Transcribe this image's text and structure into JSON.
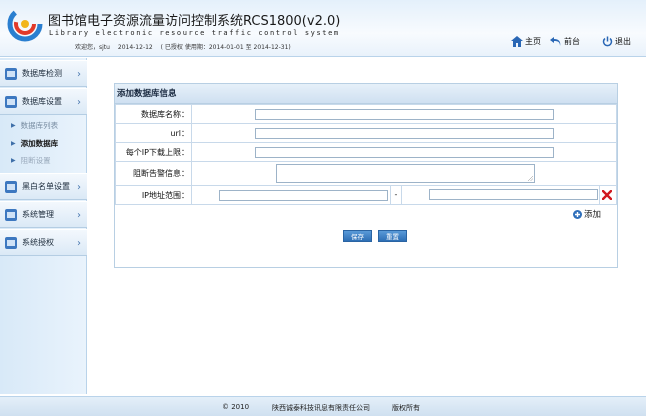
{
  "header": {
    "title_cn": "图书馆电子资源流量访问控制系统RCS1800(v2.0)",
    "title_en": "Library electronic resource traffic control system",
    "welcome_label": "欢迎您，sjtu",
    "date": "2014-12-12",
    "license": "( 已授权 使用期：2014-01-01 至 2014-12-31)",
    "nav": {
      "home": "主页",
      "back": "前台",
      "logout": "退出"
    }
  },
  "sidebar": {
    "items": [
      {
        "label": "数据库检测",
        "icon": "database-icon"
      },
      {
        "label": "数据库设置",
        "icon": "database-settings-icon"
      },
      {
        "label": "黑白名单设置",
        "icon": "blacklist-icon"
      },
      {
        "label": "系统管理",
        "icon": "system-icon"
      },
      {
        "label": "系统授权",
        "icon": "license-icon"
      }
    ],
    "subitems": [
      {
        "label": "数据库列表",
        "color": "#7a8ea3"
      },
      {
        "label": "添加数据库",
        "color": "#1a1a1a"
      },
      {
        "label": "阻断设置",
        "color": "#9aaabc"
      }
    ]
  },
  "form": {
    "title": "添加数据库信息",
    "fields": {
      "name_label": "数据库名称：",
      "url_label": "url：",
      "limit_label": "每个IP下载上限：",
      "alert_label": "阻断告警信息：",
      "ip_label": "IP地址范围：",
      "ip_separator": "-"
    },
    "add_label": "添加",
    "save_label": "保存",
    "reset_label": "重置"
  },
  "footer": {
    "copyright": "© 2010",
    "company": "陕西诚泰科技讯息有限责任公司",
    "rights": "版权所有"
  },
  "colors": {
    "accent": "#2e6fb5",
    "delete": "#d0181f"
  }
}
